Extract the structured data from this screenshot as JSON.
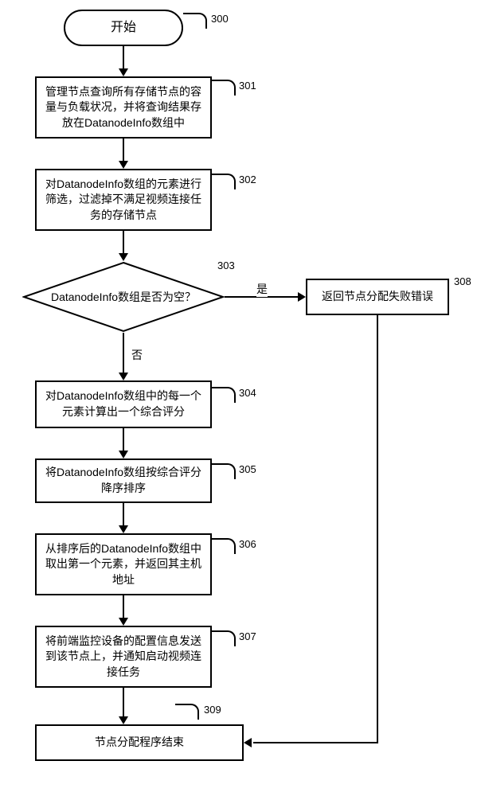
{
  "nodes": {
    "start": "开始",
    "n301": "管理节点查询所有存储节点的容量与负载状况，并将查询结果存放在DatanodeInfo数组中",
    "n302": "对DatanodeInfo数组的元素进行筛选，过滤掉不满足视频连接任务的存储节点",
    "n303": "DatanodeInfo数组是否为空？",
    "n304": "对DatanodeInfo数组中的每一个元素计算出一个综合评分",
    "n305": "将DatanodeInfo数组按综合评分降序排序",
    "n306": "从排序后的DatanodeInfo数组中取出第一个元素，并返回其主机地址",
    "n307": "将前端监控设备的配置信息发送到该节点上，并通知启动视频连接任务",
    "n308": "返回节点分配失败错误",
    "n309": "节点分配程序结束"
  },
  "refs": {
    "r300": "300",
    "r301": "301",
    "r302": "302",
    "r303": "303",
    "r304": "304",
    "r305": "305",
    "r306": "306",
    "r307": "307",
    "r308": "308",
    "r309": "309"
  },
  "edges": {
    "yes": "是",
    "no": "否"
  },
  "chart_data": {
    "type": "flowchart",
    "nodes": [
      {
        "id": "300",
        "kind": "start",
        "text": "开始"
      },
      {
        "id": "301",
        "kind": "process",
        "text": "管理节点查询所有存储节点的容量与负载状况，并将查询结果存放在DatanodeInfo数组中"
      },
      {
        "id": "302",
        "kind": "process",
        "text": "对DatanodeInfo数组的元素进行筛选，过滤掉不满足视频连接任务的存储节点"
      },
      {
        "id": "303",
        "kind": "decision",
        "text": "DatanodeInfo数组是否为空？"
      },
      {
        "id": "304",
        "kind": "process",
        "text": "对DatanodeInfo数组中的每一个元素计算出一个综合评分"
      },
      {
        "id": "305",
        "kind": "process",
        "text": "将DatanodeInfo数组按综合评分降序排序"
      },
      {
        "id": "306",
        "kind": "process",
        "text": "从排序后的DatanodeInfo数组中取出第一个元素，并返回其主机地址"
      },
      {
        "id": "307",
        "kind": "process",
        "text": "将前端监控设备的配置信息发送到该节点上，并通知启动视频连接任务"
      },
      {
        "id": "308",
        "kind": "process",
        "text": "返回节点分配失败错误"
      },
      {
        "id": "309",
        "kind": "end",
        "text": "节点分配程序结束"
      }
    ],
    "edges": [
      {
        "from": "300",
        "to": "301"
      },
      {
        "from": "301",
        "to": "302"
      },
      {
        "from": "302",
        "to": "303"
      },
      {
        "from": "303",
        "to": "308",
        "label": "是"
      },
      {
        "from": "303",
        "to": "304",
        "label": "否"
      },
      {
        "from": "304",
        "to": "305"
      },
      {
        "from": "305",
        "to": "306"
      },
      {
        "from": "306",
        "to": "307"
      },
      {
        "from": "307",
        "to": "309"
      },
      {
        "from": "308",
        "to": "309"
      }
    ]
  }
}
